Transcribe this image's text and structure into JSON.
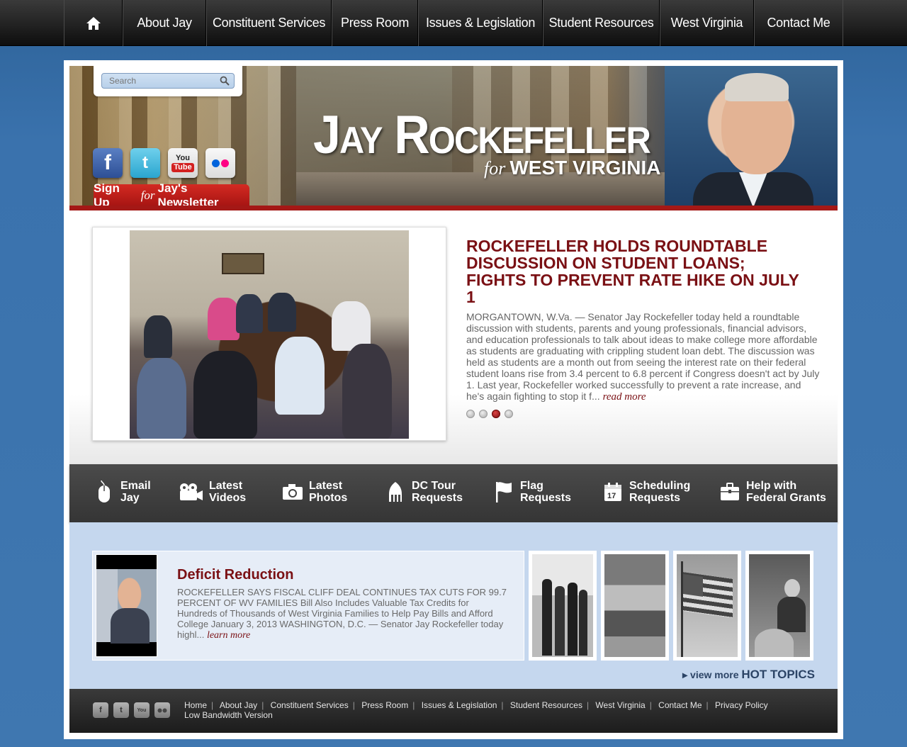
{
  "nav": {
    "items": [
      "About Jay",
      "Constituent Services",
      "Press Room",
      "Issues & Legislation",
      "Student Resources",
      "West Virginia",
      "Contact Me"
    ]
  },
  "search": {
    "placeholder": "Search"
  },
  "brand": {
    "title": "Jay Rockefeller",
    "for": "for",
    "region": "WEST VIRGINIA"
  },
  "social": {
    "facebook": "f",
    "twitter": "t",
    "youtube_you": "You",
    "youtube_tube": "Tube"
  },
  "signup": {
    "prefix": "Sign Up",
    "for": "for",
    "suffix": "Jay's Newsletter"
  },
  "feature": {
    "title": "ROCKEFELLER HOLDS ROUNDTABLE DISCUSSION ON STUDENT LOANS; FIGHTS TO PREVENT RATE HIKE ON JULY 1",
    "body": "MORGANTOWN, W.Va. — Senator Jay Rockefeller today held a roundtable discussion with students, parents and young professionals, financial advisors, and education professionals to talk about ideas to make college more affordable as students are graduating with crippling student loan debt. The discussion was held as students are a month out from seeing the interest rate on their federal student loans rise from 3.4 percent to 6.8 percent if Congress doesn't act by July 1. Last year, Rockefeller worked successfully to prevent a rate increase, and he's again fighting to stop it f...",
    "read_more": "read more"
  },
  "quicklinks": [
    {
      "line1": "Email",
      "line2": "Jay"
    },
    {
      "line1": "Latest",
      "line2": "Videos"
    },
    {
      "line1": "Latest",
      "line2": "Photos"
    },
    {
      "line1": "DC Tour",
      "line2": "Requests"
    },
    {
      "line1": "Flag",
      "line2": "Requests"
    },
    {
      "line1": "Scheduling",
      "line2": "Requests"
    },
    {
      "line1": "Help with",
      "line2": "Federal Grants"
    }
  ],
  "calendar_day": "17",
  "topic": {
    "title": "Deficit Reduction",
    "body": "ROCKEFELLER SAYS FISCAL CLIFF DEAL CONTINUES TAX CUTS FOR 99.7 PERCENT OF WV FAMILIES Bill Also Includes Valuable Tax Credits for Hundreds of Thousands of West Virginia Families to Help Pay Bills and Afford College January 3, 2013 WASHINGTON, D.C. — Senator Jay Rockefeller today highl...",
    "learn_more": "learn more"
  },
  "view_more": {
    "prefix": "▸ view more",
    "hot": "HOT TOPICS"
  },
  "footer": {
    "links": [
      "Home",
      "About Jay",
      "Constituent Services",
      "Press Room",
      "Issues & Legislation",
      "Student Resources",
      "West Virginia",
      "Contact Me",
      "Privacy Policy"
    ],
    "low_bandwidth": "Low Bandwidth Version"
  },
  "colors": {
    "accent_red": "#7a1014",
    "banner_red": "#a41816",
    "page_blue": "#3a72ad",
    "topics_blue": "#c5d7ee"
  }
}
